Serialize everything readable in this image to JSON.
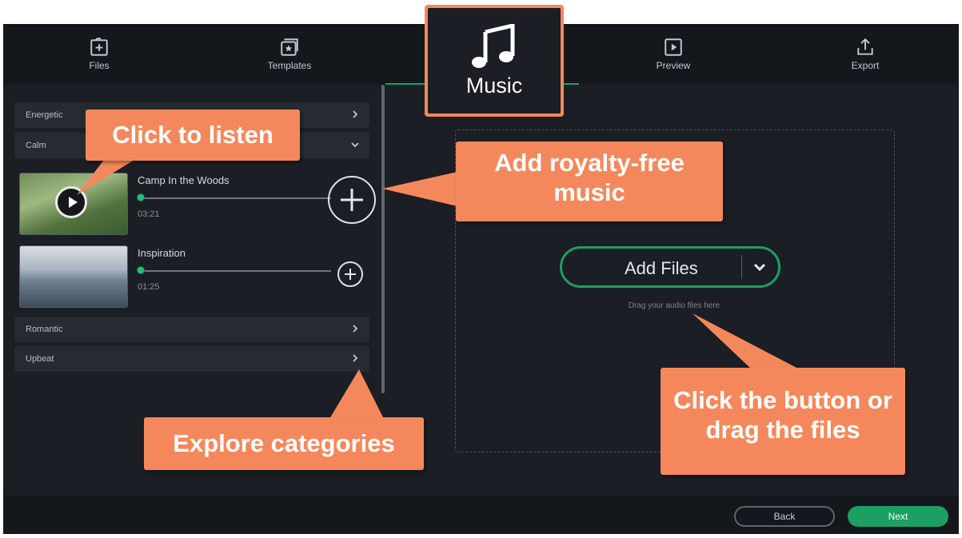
{
  "nav": {
    "items": [
      {
        "label": "Files",
        "icon": "add-file-icon"
      },
      {
        "label": "Templates",
        "icon": "templates-icon"
      },
      {
        "label": "Music",
        "icon": "music-note-icon"
      },
      {
        "label": "Preview",
        "icon": "preview-icon"
      },
      {
        "label": "Export",
        "icon": "export-icon"
      }
    ],
    "active": "Music"
  },
  "categories": {
    "energetic": "Energetic",
    "calm": "Calm",
    "romantic": "Romantic",
    "upbeat": "Upbeat"
  },
  "tracks": [
    {
      "title": "Camp In the Woods",
      "duration": "03:21"
    },
    {
      "title": "Inspiration",
      "duration": "01:25"
    }
  ],
  "dropzone": {
    "add_files_label": "Add Files",
    "hint": "Drag your audio files here"
  },
  "footer": {
    "back_label": "Back",
    "next_label": "Next"
  },
  "callouts": {
    "listen": "Click to listen",
    "royalty_free": "Add royalty-free music",
    "click_drag": "Click the button or drag the files",
    "explore": "Explore categories"
  },
  "colors": {
    "accent_green": "#1c9f62",
    "callout_orange": "#f4885c",
    "app_background": "#1b1e24"
  }
}
